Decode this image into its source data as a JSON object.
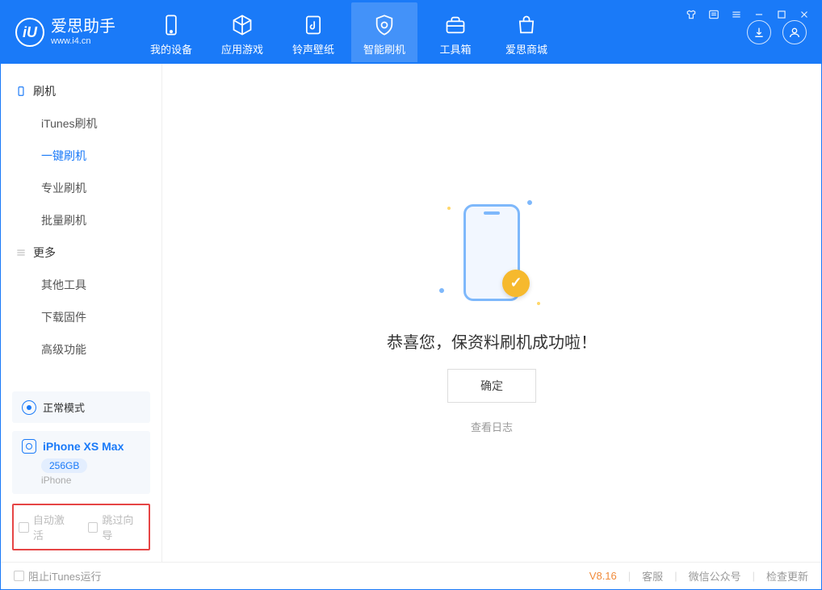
{
  "brand": {
    "title": "爱思助手",
    "subtitle": "www.i4.cn"
  },
  "nav": {
    "my_device": "我的设备",
    "apps_games": "应用游戏",
    "ringtones": "铃声壁纸",
    "smart_flash": "智能刷机",
    "toolbox": "工具箱",
    "store": "爱思商城"
  },
  "sidebar": {
    "section_flash": "刷机",
    "items_flash": {
      "itunes": "iTunes刷机",
      "oneclick": "一键刷机",
      "pro": "专业刷机",
      "batch": "批量刷机"
    },
    "section_more": "更多",
    "items_more": {
      "other_tools": "其他工具",
      "download_fw": "下载固件",
      "advanced": "高级功能"
    },
    "mode_label": "正常模式",
    "device_name": "iPhone XS Max",
    "device_storage": "256GB",
    "device_type": "iPhone",
    "auto_activate": "自动激活",
    "skip_guide": "跳过向导"
  },
  "main": {
    "success_message": "恭喜您，保资料刷机成功啦！",
    "confirm_button": "确定",
    "view_log": "查看日志"
  },
  "statusbar": {
    "block_itunes": "阻止iTunes运行",
    "version": "V8.16",
    "customer_service": "客服",
    "wechat": "微信公众号",
    "check_update": "检查更新"
  }
}
